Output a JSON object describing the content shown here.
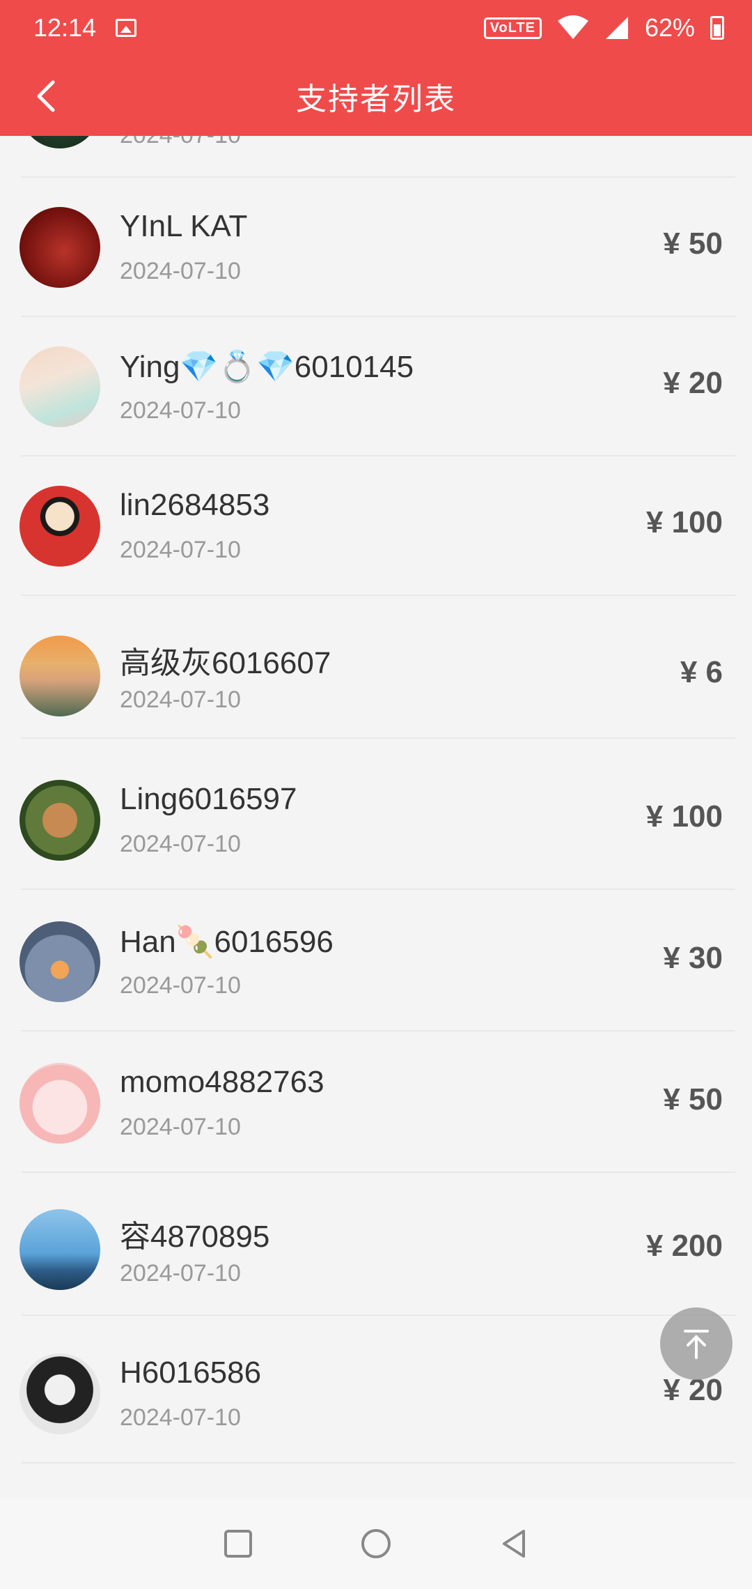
{
  "status_bar": {
    "time": "12:14",
    "volte": "VoLTE",
    "battery_percent": "62%"
  },
  "header": {
    "title": "支持者列表"
  },
  "supporters": [
    {
      "name": "",
      "date": "2024-07-10",
      "amount": ""
    },
    {
      "name": "YInL KAT",
      "date": "2024-07-10",
      "amount": "¥ 50"
    },
    {
      "name": "Ying💎💍💎6010145",
      "date": "2024-07-10",
      "amount": "¥ 20"
    },
    {
      "name": "lin2684853",
      "date": "2024-07-10",
      "amount": "¥ 100"
    },
    {
      "name": "高级灰6016607",
      "date": "2024-07-10",
      "amount": "¥ 6"
    },
    {
      "name": "Ling6016597",
      "date": "2024-07-10",
      "amount": "¥ 100"
    },
    {
      "name": "Han🍡6016596",
      "date": "2024-07-10",
      "amount": "¥ 30"
    },
    {
      "name": "momo4882763",
      "date": "2024-07-10",
      "amount": "¥ 50"
    },
    {
      "name": "容4870895",
      "date": "2024-07-10",
      "amount": "¥ 200"
    },
    {
      "name": "H6016586",
      "date": "2024-07-10",
      "amount": "¥ 20"
    }
  ],
  "colors": {
    "header_bg": "#ef4b4b",
    "amount_text": "#555555",
    "date_text": "#999999"
  },
  "icons": {
    "back": "chevron-left-icon",
    "scroll_top": "arrow-up-to-top-icon",
    "nav_recent": "square-icon",
    "nav_home": "circle-icon",
    "nav_back": "triangle-back-icon"
  }
}
